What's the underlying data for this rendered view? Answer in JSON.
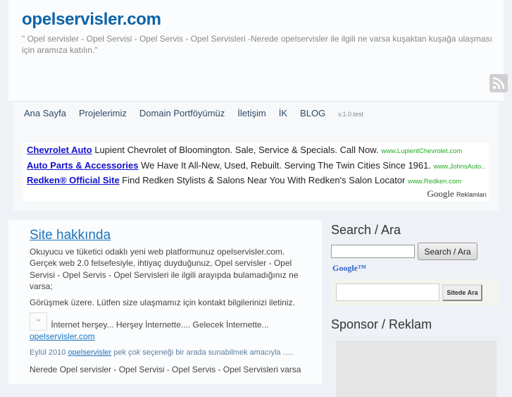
{
  "header": {
    "title": "opelservisler.com",
    "tagline": "\" Opel servisler - Opel Servisi - Opel Servis - Opel Servisleri -Nerede opelservisler ile ilgili ne varsa kuşaktan kuşağa ulaşması için aramıza katılın.\""
  },
  "nav": {
    "items": [
      "Ana Sayfa",
      "Projelerimiz",
      "Domain Portföyümüz",
      "İletişim",
      "İK",
      "BLOG"
    ],
    "version": "v.1.0.test"
  },
  "ads": [
    {
      "title": "Chevrolet Auto",
      "text": "Lupient Chevrolet of Bloomington. Sale, Service & Specials. Call Now.",
      "url": "www.LupientChevrolet.com"
    },
    {
      "title": "Auto Parts & Accessories",
      "text": "We Have It All-New, Used, Rebuilt. Serving The Twin Cities Since 1961.",
      "url": "www.JohnsAuto..."
    },
    {
      "title": "Redken® Official Site",
      "text": "Find Redken Stylists & Salons Near You With Redken's Salon Locator",
      "url": "www.Redken.com"
    }
  ],
  "google_ads": {
    "logo": "Google",
    "label": "Reklamları"
  },
  "content": {
    "title": "Site hakkında",
    "p1": "Okuyucu ve tüketici odaklı yeni web platformunuz opelservisler.com. Gerçek web 2.0 felsefesiyle, ihtiyaç duyduğunuz, Opel servisler - Opel Servisi - Opel Servis - Opel Servisleri ile ilgili arayıpda bulamadığınız ne varsa;",
    "p2": "Görüşmek üzere. Lütfen size ulaşmamız için kontakt bilgilerinizi iletiniz.",
    "quote_mark": "“",
    "quote": "İnternet herşey... Herşey İnternette.... Gelecek İnternette...",
    "quote_link": "opelservisler.com",
    "date": "Eylül 2010",
    "date_link": "opelservisler",
    "date_text1": "pek",
    "date_em": "çok",
    "date_text2": "seçeneği bir arada sunabilmek amacıyla .....",
    "p3": "Nerede Opel servisler - Opel Servisi - Opel Servis - Opel Servisleri varsa"
  },
  "sidebar": {
    "search_title": "Search / Ara",
    "search_button": "Search / Ara",
    "google_logo": "Google™",
    "site_search_button": "Sitede Ara",
    "sponsor_title": "Sponsor / Reklam"
  }
}
